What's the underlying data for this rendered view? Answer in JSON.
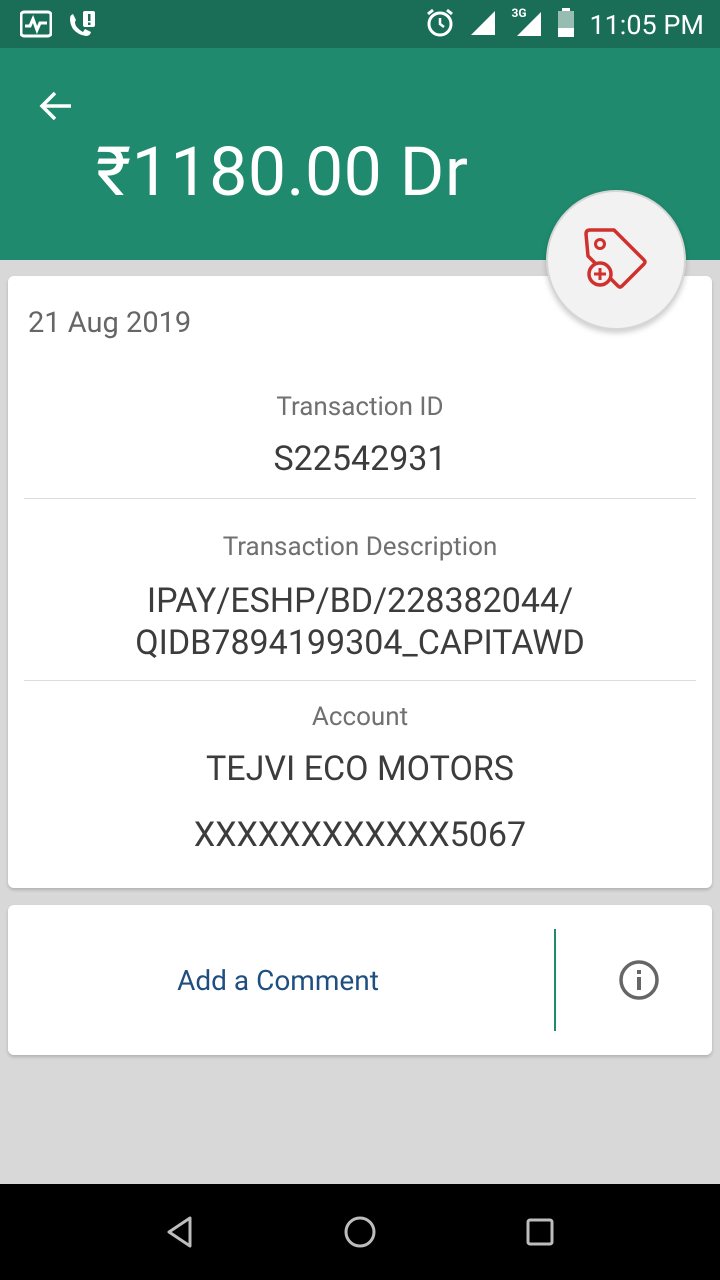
{
  "status_bar": {
    "time": "11:05 PM",
    "network": "3G",
    "icons": [
      "activity-icon",
      "phone-alert-icon",
      "alarm-icon",
      "signal-icon",
      "signal-3g-icon",
      "battery-icon"
    ]
  },
  "header": {
    "amount": "₹1180.00 Dr",
    "back_icon": "arrow-back-icon",
    "color": "#1f8a6e"
  },
  "transaction": {
    "date": "21 Aug 2019",
    "id_label": "Transaction ID",
    "id_value": "S22542931",
    "description_label": "Transaction Description",
    "description_line1": "IPAY/ESHP/BD/228382044/",
    "description_line2": "QIDB7894199304_CAPITAWD",
    "account_label": "Account",
    "account_name": "TEJVI ECO MOTORS",
    "account_number": "XXXXXXXXXXXX5067"
  },
  "tag_button": {
    "icon": "add-tag-icon",
    "color": "#d0312d"
  },
  "comment": {
    "label": "Add a Comment",
    "info_icon": "info-icon"
  },
  "nav": {
    "icons": [
      "back-triangle-icon",
      "home-circle-icon",
      "recents-square-icon"
    ]
  }
}
